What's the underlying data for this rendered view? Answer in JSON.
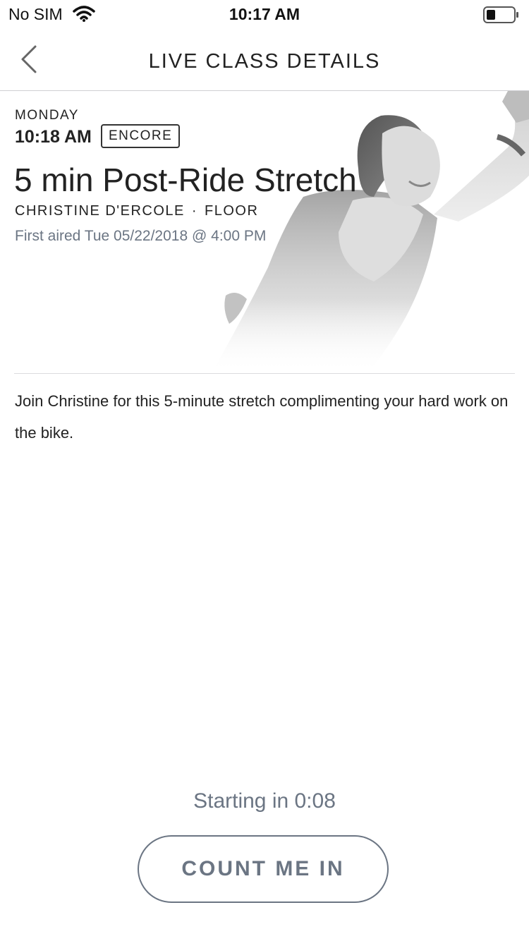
{
  "status_bar": {
    "carrier": "No SIM",
    "time": "10:17 AM",
    "icons": [
      "wifi-icon",
      "battery-icon"
    ]
  },
  "nav": {
    "title": "LIVE CLASS DETAILS",
    "back_icon": "chevron-left-icon"
  },
  "class": {
    "day": "MONDAY",
    "time": "10:18 AM",
    "badge": "ENCORE",
    "title": "5 min Post-Ride Stretch",
    "instructor": "CHRISTINE D'ERCOLE",
    "separator": "·",
    "category": "FLOOR",
    "first_aired": "First aired Tue 05/22/2018 @ 4:00 PM",
    "description": "Join Christine for this 5-minute stretch complimenting your hard work on the bike."
  },
  "footer": {
    "countdown": "Starting in 0:08",
    "button_label": "COUNT ME IN"
  },
  "colors": {
    "accent_gray": "#6b7583",
    "text": "#222222",
    "divider": "#dcdcdf"
  }
}
